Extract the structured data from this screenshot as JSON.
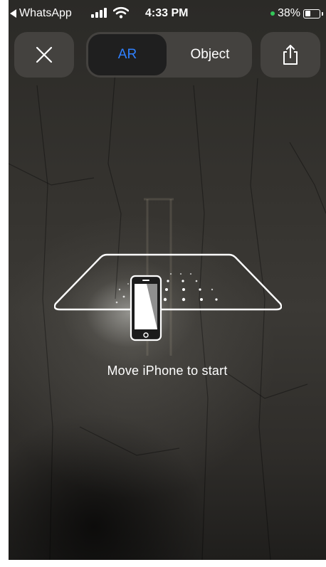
{
  "status_bar": {
    "back_app": "WhatsApp",
    "time": "4:33 PM",
    "battery_percent": "38%",
    "battery_level": 0.38,
    "icons": [
      "back-arrow-icon",
      "cellular-signal-icon",
      "wifi-icon",
      "battery-icon"
    ]
  },
  "toolbar": {
    "close_icon": "close-icon",
    "share_icon": "share-icon",
    "segments": [
      {
        "label": "AR",
        "selected": true
      },
      {
        "label": "Object",
        "selected": false
      }
    ]
  },
  "coaching": {
    "message": "Move iPhone to start",
    "icon": "iphone-coaching-icon"
  },
  "colors": {
    "selected_segment_text": "#2f80ff",
    "control_background": "#48463f",
    "location_dot": "#34c759"
  }
}
